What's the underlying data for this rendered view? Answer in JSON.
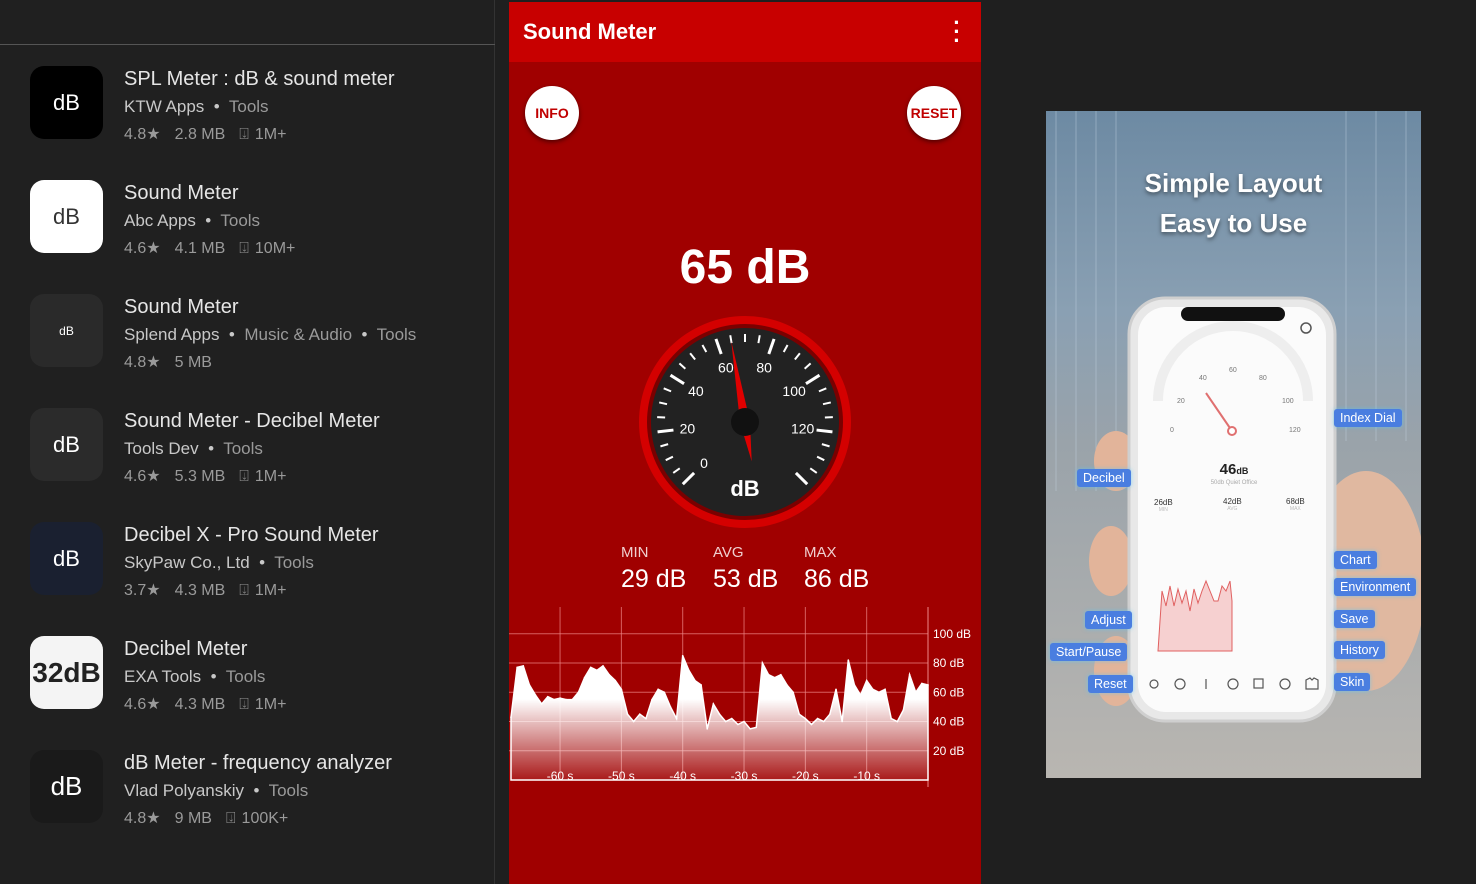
{
  "apps": [
    {
      "title": "SPL Meter : dB & sound meter",
      "developer": "KTW Apps",
      "categories": [
        "Tools"
      ],
      "rating": "4.8★",
      "size": "2.8 MB",
      "downloads": "1M+",
      "icon": "dB"
    },
    {
      "title": "Sound Meter",
      "developer": "Abc Apps",
      "categories": [
        "Tools"
      ],
      "rating": "4.6★",
      "size": "4.1 MB",
      "downloads": "10M+",
      "icon": "dB"
    },
    {
      "title": "Sound Meter",
      "developer": "Splend Apps",
      "categories": [
        "Music & Audio",
        "Tools"
      ],
      "rating": "4.8★",
      "size": "5 MB",
      "downloads": "",
      "icon": "dB"
    },
    {
      "title": "Sound Meter - Decibel Meter",
      "developer": "Tools Dev",
      "categories": [
        "Tools"
      ],
      "rating": "4.6★",
      "size": "5.3 MB",
      "downloads": "1M+",
      "icon": "dB"
    },
    {
      "title": "Decibel X - Pro Sound Meter",
      "developer": "SkyPaw Co., Ltd",
      "categories": [
        "Tools"
      ],
      "rating": "3.7★",
      "size": "4.3 MB",
      "downloads": "1M+",
      "icon": "dB"
    },
    {
      "title": "Decibel Meter",
      "developer": "EXA Tools",
      "categories": [
        "Tools"
      ],
      "rating": "4.6★",
      "size": "4.3 MB",
      "downloads": "1M+",
      "icon": "32dB"
    },
    {
      "title": "dB Meter - frequency analyzer",
      "developer": "Vlad Polyanskiy",
      "categories": [
        "Tools"
      ],
      "rating": "4.8★",
      "size": "9 MB",
      "downloads": "100K+",
      "icon": "dB"
    }
  ],
  "meter": {
    "title": "Sound Meter",
    "info": "INFO",
    "reset": "RESET",
    "current": "65 dB",
    "current_value": 65,
    "unit": "dB",
    "dial_ticks": [
      "0",
      "20",
      "40",
      "60",
      "80",
      "100",
      "120"
    ],
    "min_label": "MIN",
    "min": "29 dB",
    "avg_label": "AVG",
    "avg": "53 dB",
    "max_label": "MAX",
    "max": "86 dB",
    "accent": "#c80000"
  },
  "chart_data": {
    "type": "area",
    "x_ticks": [
      "-60 s",
      "-50 s",
      "-40 s",
      "-30 s",
      "-20 s",
      "-10 s"
    ],
    "y_ticks": [
      "100 dB",
      "80 dB",
      "60 dB",
      "40 dB",
      "20 dB"
    ],
    "xlim": [
      -68,
      0
    ],
    "ylim": [
      0,
      110
    ],
    "grid": true,
    "x": [
      -68,
      -67,
      -66,
      -65,
      -64,
      -63,
      -62,
      -61,
      -60,
      -59,
      -58,
      -57,
      -56,
      -55,
      -54,
      -53,
      -52,
      -51,
      -50,
      -49,
      -48,
      -47,
      -46,
      -45,
      -44,
      -43,
      -42,
      -41,
      -40,
      -39,
      -38,
      -37,
      -36,
      -35,
      -34,
      -33,
      -32,
      -31,
      -30,
      -29,
      -28,
      -27,
      -26,
      -25,
      -24,
      -23,
      -22,
      -21,
      -20,
      -19,
      -18,
      -17,
      -16,
      -15,
      -14,
      -13,
      -12,
      -11,
      -10,
      -9,
      -8,
      -7,
      -6,
      -5,
      -4,
      -3,
      -2,
      -1,
      0
    ],
    "y": [
      43,
      77,
      78,
      65,
      58,
      52,
      57,
      55,
      56,
      55,
      55,
      60,
      70,
      77,
      75,
      78,
      72,
      68,
      62,
      45,
      40,
      45,
      42,
      55,
      62,
      60,
      50,
      42,
      85,
      75,
      68,
      65,
      35,
      52,
      45,
      40,
      42,
      38,
      40,
      35,
      36,
      80,
      72,
      70,
      72,
      65,
      60,
      45,
      42,
      38,
      42,
      40,
      45,
      62,
      40,
      82,
      65,
      58,
      68,
      62,
      60,
      62,
      42,
      40,
      48,
      72,
      60,
      66,
      65
    ]
  },
  "promo": {
    "headline1": "Simple Layout",
    "headline2": "Easy to Use",
    "reading": "46",
    "reading_unit": "dB",
    "reading_note": "50db  Quiet Office",
    "dial_ticks": [
      "0",
      "20",
      "40",
      "60",
      "80",
      "100",
      "120"
    ],
    "min": "26dB",
    "min_label": "MIN",
    "avg": "42dB",
    "avg_label": "AVG",
    "max": "68dB",
    "max_label": "MAX",
    "labels": {
      "index_dial": "Index Dial",
      "decibel": "Decibel",
      "chart": "Chart",
      "environment": "Environment",
      "adjust": "Adjust",
      "save": "Save",
      "start_pause": "Start/Pause",
      "history": "History",
      "reset": "Reset",
      "skin": "Skin"
    }
  }
}
